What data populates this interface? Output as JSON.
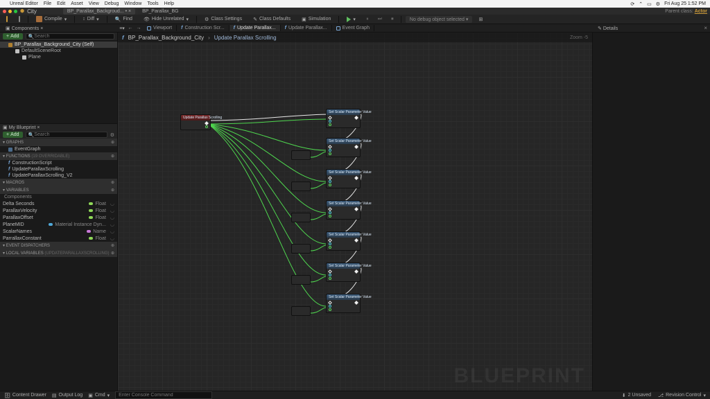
{
  "mac": {
    "app": "Unreal Editor",
    "menus": [
      "File",
      "Edit",
      "Asset",
      "View",
      "Debug",
      "Window",
      "Tools",
      "Help"
    ],
    "clock": "Fri Aug 25  1:52 PM"
  },
  "window": {
    "project": "City",
    "tabs": [
      {
        "label": "BP_Parallax_Backgroud...",
        "active": true
      },
      {
        "label": "BP_Parallax_BG"
      }
    ],
    "parent_hint": "Parent class:",
    "parent_class": "Actor"
  },
  "toolbar": {
    "compile": "Compile",
    "diff": "Diff",
    "find": "Find",
    "hide_unrelated": "Hide Unrelated",
    "class_settings": "Class Settings",
    "class_defaults": "Class Defaults",
    "simulation": "Simulation",
    "no_debug": "No debug object selected"
  },
  "panels": {
    "components_tab": "Components",
    "my_blueprint_tab": "My Blueprint",
    "details_tab": "Details"
  },
  "graph_tabs": [
    {
      "label": "Viewport",
      "icon": "viewport"
    },
    {
      "label": "Construction Scr...",
      "icon": "func"
    },
    {
      "label": "Update Parallax...",
      "icon": "func",
      "active": true
    },
    {
      "label": "Update Parallax...",
      "icon": "func"
    },
    {
      "label": "Event Graph",
      "icon": "graph"
    }
  ],
  "components": {
    "add": "Add",
    "search_ph": "Search",
    "tree": [
      {
        "label": "BP_Parallax_Background_City (Self)",
        "icon": "#b08030",
        "sel": true
      },
      {
        "label": "DefaultSceneRoot",
        "icon": "#c0c0c0",
        "indent": 1
      },
      {
        "label": "Plane",
        "icon": "#c0c0c0",
        "indent": 2
      }
    ]
  },
  "my_blueprint": {
    "add": "Add",
    "search_ph": "Search",
    "sections": {
      "graphs": "Graphs",
      "functions": "Functions",
      "functions_hint": "(19 Overridable)",
      "macros": "Macros",
      "variables": "Variables",
      "components_hdr": "Components",
      "event_dispatchers": "Event Dispatchers",
      "local_vars": "Local Variables",
      "local_vars_hint": "(UpdateParallaxScrolling)"
    },
    "graphs_items": [
      {
        "label": "EventGraph",
        "icon": "#4a6a8a"
      }
    ],
    "functions_items": [
      {
        "label": "ConstructionScript"
      },
      {
        "label": "UpdateParallaxScrolling"
      },
      {
        "label": "UpdateParallaxScrolling_V2"
      }
    ],
    "variables": [
      {
        "name": "Delta Seconds",
        "type": "Float",
        "color": "#8fd858"
      },
      {
        "name": "ParallaxVelocity",
        "type": "Float",
        "color": "#8fd858"
      },
      {
        "name": "ParallaxOffset",
        "type": "Float",
        "color": "#8fd858"
      },
      {
        "name": "PlaneMID",
        "type": "Material Instance Dyn...",
        "color": "#4fa8d8"
      },
      {
        "name": "ScalarNames",
        "type": "Name",
        "color": "#c878d8"
      },
      {
        "name": "ParrallaxConstant",
        "type": "Float",
        "color": "#8fd858"
      }
    ]
  },
  "graph": {
    "nav_back": "←",
    "nav_fwd": "→",
    "crumb1": "BP_Parallax_Background_City",
    "crumb2": "Update Parallax Scrolling",
    "zoom": "Zoom  -5",
    "watermark": "BLUEPRINT",
    "event_node": "Update Parallax Scrolling",
    "target_nodes": [
      "Set Scalar Parameter Value",
      "Set Scalar Parameter Value",
      "Set Scalar Parameter Value",
      "Set Scalar Parameter Value",
      "Set Scalar Parameter Value",
      "Set Scalar Parameter Value",
      "Set Scalar Parameter Value"
    ]
  },
  "status": {
    "content_drawer": "Content Drawer",
    "output_log": "Output Log",
    "cmd": "Cmd",
    "cmd_ph": "Enter Console Command",
    "unsaved": "2 Unsaved",
    "revision": "Revision Control"
  }
}
